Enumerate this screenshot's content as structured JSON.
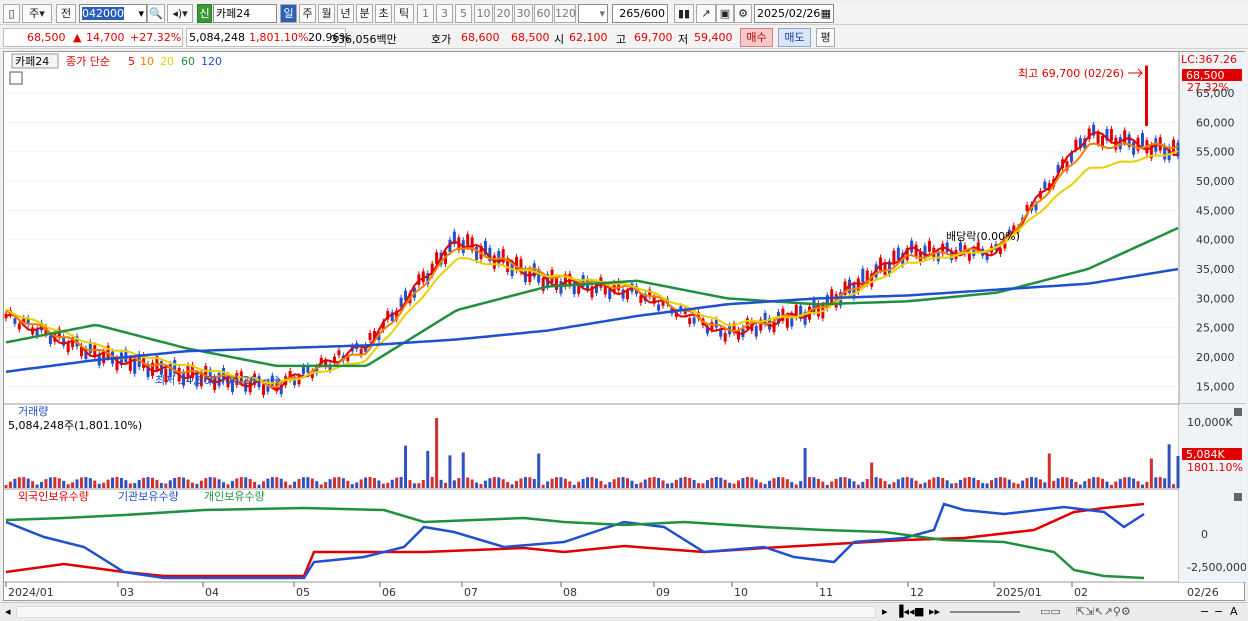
{
  "toolbar": {
    "code": "042000",
    "mode_a": "주",
    "mode_b": "전",
    "new_badge": "신",
    "stock_name": "카페24",
    "periods": [
      "일",
      "주",
      "월",
      "년",
      "분",
      "초",
      "틱"
    ],
    "ticks": [
      "1",
      "3",
      "5",
      "10",
      "20",
      "30",
      "60",
      "120"
    ],
    "count": "265",
    "count_total": "/600",
    "date": "2025/02/26"
  },
  "quote": {
    "price": "68,500",
    "change": "14,700",
    "change_pct": "+27.32%",
    "volume": "5,084,248",
    "volume_pct": "1,801.10%",
    "turnover_pct": "20.96%",
    "amount": "336,056백만",
    "ask_label": "호가",
    "ask": "68,600",
    "bid": "68,500",
    "open_label": "시",
    "open": "62,100",
    "high_label": "고",
    "high": "69,700",
    "low_label": "저",
    "low": "59,400",
    "buy": "매수",
    "sell": "매도",
    "eval": "평"
  },
  "legend": {
    "name": "카페24",
    "price_label": "종가 단순",
    "ma": [
      {
        "label": "5",
        "color": "#e00000"
      },
      {
        "label": "10",
        "color": "#f08000"
      },
      {
        "label": "20",
        "color": "#e8d000"
      },
      {
        "label": "60",
        "color": "#209040"
      },
      {
        "label": "120",
        "color": "#2050d0"
      }
    ]
  },
  "annotations": {
    "high": "최고 69,700 (02/26)",
    "low": "최저 14,660 (04/26)",
    "ex": "배당락(0.00%)"
  },
  "price_axis": {
    "lc": "LC:367.26",
    "last": "68,500",
    "pct": "27.32%",
    "ticks": [
      "65,000",
      "60,000",
      "55,000",
      "50,000",
      "45,000",
      "40,000",
      "35,000",
      "30,000",
      "25,000",
      "20,000",
      "15,000"
    ]
  },
  "volume_panel": {
    "title": "거래량",
    "value": "5,084,248주(1,801.10%)",
    "axis_tick": "10,000K",
    "last": "5,084K",
    "last_pct": "1801.10%"
  },
  "holdings_panel": {
    "legend": [
      {
        "label": "외국인보유수량",
        "color": "#e00000"
      },
      {
        "label": "기관보유수량",
        "color": "#2050d0"
      },
      {
        "label": "개인보유수량",
        "color": "#209040"
      }
    ],
    "ticks": [
      "0",
      "-2,500,000"
    ]
  },
  "x_axis": {
    "labels": [
      "2024/01",
      "03",
      "04",
      "05",
      "06",
      "07",
      "08",
      "09",
      "10",
      "11",
      "12",
      "2025/01",
      "02"
    ],
    "right_label": "02/26"
  },
  "chart_data": {
    "type": "line",
    "x": [
      "2024/01",
      "03",
      "04",
      "05",
      "06",
      "07",
      "08",
      "09",
      "10",
      "11",
      "12",
      "2025/01",
      "02",
      "02/26"
    ],
    "ylim": [
      12000,
      72000
    ],
    "series": [
      {
        "name": "5",
        "values": [
          27000,
          20500,
          17000,
          15000,
          22000,
          40000,
          33000,
          31000,
          24000,
          28000,
          38000,
          38000,
          58000,
          55000
        ]
      },
      {
        "name": "10",
        "values": [
          27500,
          21000,
          17500,
          15200,
          21000,
          39000,
          34000,
          31500,
          24500,
          28000,
          37000,
          38500,
          56000,
          56000
        ]
      },
      {
        "name": "20",
        "values": [
          28000,
          22000,
          18500,
          15500,
          19500,
          37000,
          34000,
          32000,
          25500,
          27500,
          36000,
          38500,
          52000,
          55000
        ]
      },
      {
        "name": "60",
        "values": [
          22500,
          25500,
          21500,
          18500,
          18500,
          28000,
          32000,
          33000,
          30000,
          29000,
          29500,
          31000,
          35000,
          42000
        ]
      },
      {
        "name": "120",
        "values": [
          17500,
          19500,
          21000,
          21500,
          22000,
          23000,
          24500,
          27000,
          29000,
          30000,
          30500,
          31500,
          32500,
          35000
        ]
      }
    ]
  }
}
